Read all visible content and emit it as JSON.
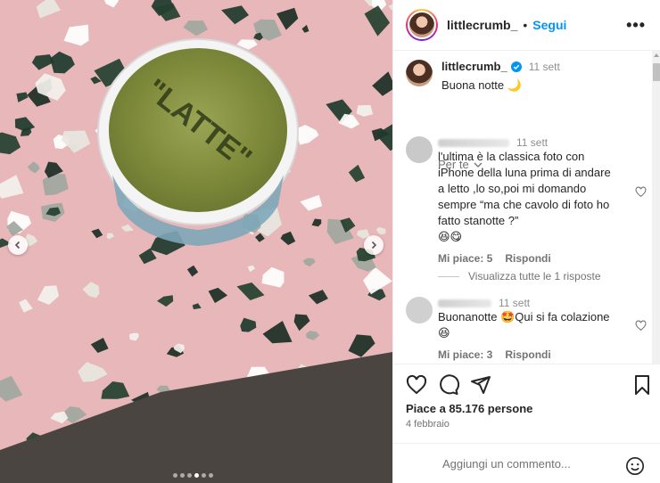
{
  "post": {
    "username": "littlecrumb_",
    "follow_label": "Segui",
    "more_label": "•••",
    "caption_time": "11 sett",
    "caption_text": "Buona notte 🌙",
    "see_translation": "Per te",
    "cup_text": "\"LATTE\"",
    "carousel_count": 6,
    "carousel_active": 3
  },
  "comments": [
    {
      "time": "11 sett",
      "text_lines": [
        "l'ultima è la classica foto con",
        "iPhone della luna prima di andare",
        "a letto ,lo so,poi mi domando",
        "sempre “ma che cavolo di foto ho",
        "fatto stanotte ?”",
        "😆😋"
      ],
      "likes": "Mi piace: 5",
      "reply": "Rispondi",
      "view_replies": "Visualizza tutte le 1 risposte"
    },
    {
      "time": "11 sett",
      "text_lines": [
        "Buonanotte 🤩Qui si fa colazione",
        "😆"
      ],
      "likes": "Mi piace: 3",
      "reply": "Rispondi"
    }
  ],
  "footer": {
    "likes_text": "Piace a 85.176 persone",
    "date": "4 febbraio",
    "comment_placeholder": "Aggiungi un commento..."
  },
  "colors": {
    "accent": "#0095f6",
    "muted": "#737373",
    "verified": "#0095f6"
  },
  "icons": [
    "heart-icon",
    "comment-icon",
    "share-icon",
    "bookmark-icon",
    "emoji-icon",
    "verified-icon",
    "chevron-left-icon",
    "chevron-right-icon",
    "chevron-down-icon"
  ]
}
